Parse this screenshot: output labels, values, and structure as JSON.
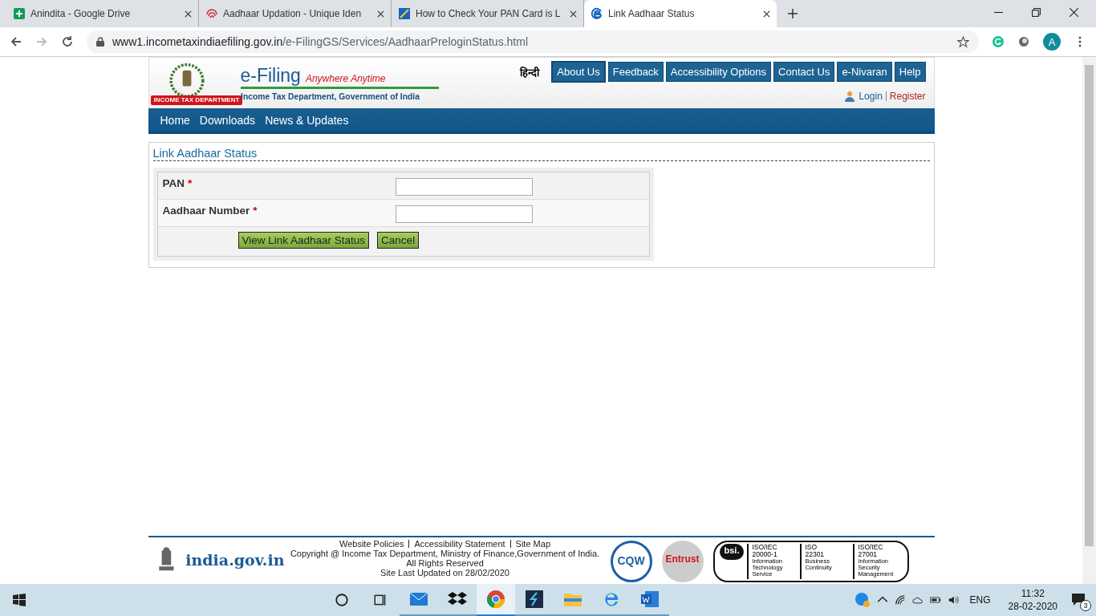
{
  "browser": {
    "tabs": [
      {
        "kind": "drive",
        "title": "Anindita - Google Drive",
        "selected": false
      },
      {
        "kind": "aadhaar",
        "title": "Aadhaar Updation - Unique Iden",
        "selected": false
      },
      {
        "kind": "pan",
        "title": "How to Check Your PAN Card is L",
        "selected": false
      },
      {
        "kind": "ie",
        "title": "Link Aadhaar Status",
        "selected": true
      }
    ],
    "url_host": "www1.incometaxindiaefiling.gov.in",
    "url_path": "/e-FilingGS/Services/AadhaarPreloginStatus.html",
    "avatar": "A"
  },
  "header": {
    "brand": "e-Filing",
    "tagline": "Anywhere Anytime",
    "subtitle": "Income Tax Department, Government of India",
    "ribbon": "INCOME TAX DEPARTMENT",
    "language": "हिन्दी",
    "top_nav": [
      "About Us",
      "Feedback",
      "Accessibility Options",
      "Contact Us",
      "e-Nivaran",
      "Help"
    ],
    "login": "Login",
    "register": "Register"
  },
  "main_nav": [
    "Home",
    "Downloads",
    "News & Updates"
  ],
  "form": {
    "title": "Link Aadhaar Status",
    "required_mark": "*",
    "fields": [
      {
        "label": "PAN",
        "required": true
      },
      {
        "label": "Aadhaar Number",
        "required": true
      }
    ],
    "buttons": [
      "View Link Aadhaar Status",
      "Cancel"
    ]
  },
  "footer": {
    "links": [
      "Website Policies",
      "Accessibility Statement",
      "Site Map"
    ],
    "lines": [
      "Copyright @ Income Tax Department, Ministry of Finance,Government of India.",
      "All Rights Reserved",
      "Site Last Updated on 28/02/2020"
    ],
    "india_gov": "india.gov.in",
    "cqw": "CQW",
    "entrust": "Entrust",
    "bsi": "bsi.",
    "certs": [
      {
        "code": "ISO/IEC",
        "number": "20000-1",
        "desc": "Information Technology Service"
      },
      {
        "code": "ISO",
        "number": "22301",
        "desc": "Business Continuity"
      },
      {
        "code": "ISO/IEC",
        "number": "27001",
        "desc": "Information Security Management"
      }
    ]
  },
  "taskbar": {
    "apps": [
      {
        "kind": "mail",
        "active": false
      },
      {
        "kind": "dropbox",
        "active": false
      },
      {
        "kind": "chrome",
        "active": true
      },
      {
        "kind": "slate",
        "active": false
      },
      {
        "kind": "explorer",
        "active": false
      },
      {
        "kind": "edge",
        "active": false
      },
      {
        "kind": "word",
        "active": false
      }
    ],
    "language": "ENG",
    "time": "11:32",
    "date": "28-02-2020",
    "notifications": "3"
  }
}
